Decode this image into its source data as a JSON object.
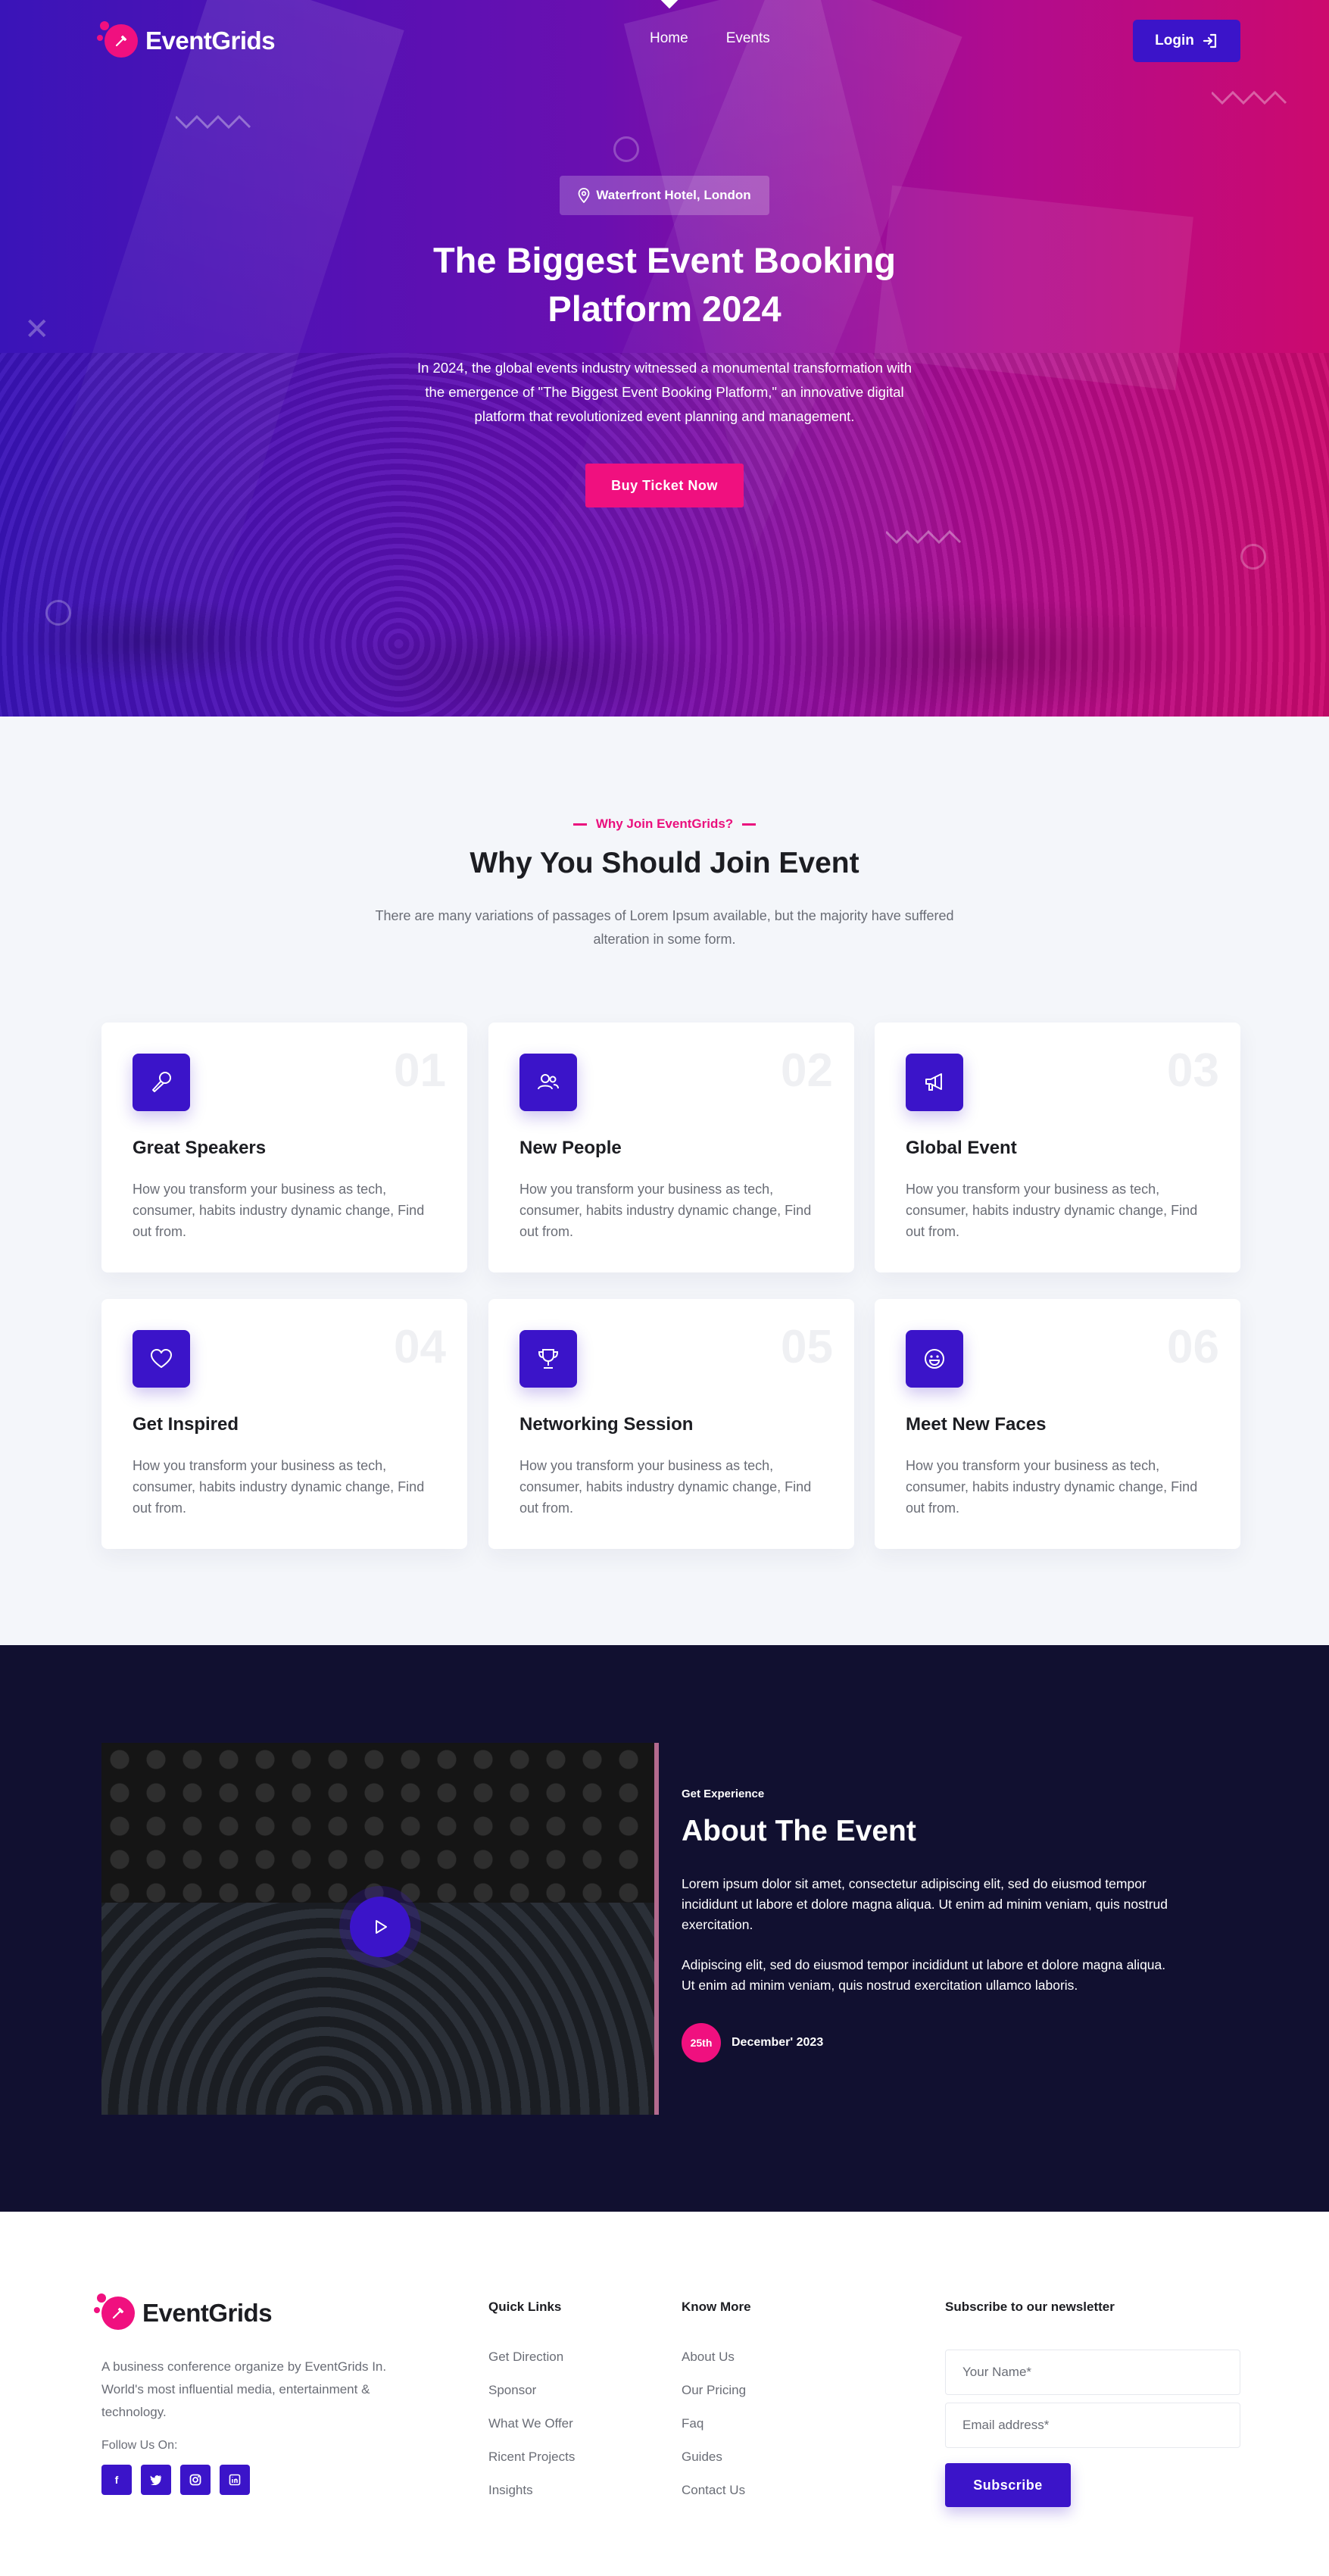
{
  "brand": {
    "name": "EventGrids"
  },
  "nav": {
    "links": [
      "Home",
      "Events"
    ],
    "login_label": "Login"
  },
  "hero": {
    "location": "Waterfront Hotel, London",
    "title": "The Biggest Event Booking Platform 2024",
    "description": "In 2024, the global events industry witnessed a monumental transformation with the emergence of \"The Biggest Event Booking Platform,\" an innovative digital platform that revolutionized event planning and management.",
    "cta_label": "Buy Ticket Now"
  },
  "why": {
    "eyebrow": "Why Join EventGrids?",
    "title": "Why You Should Join Event",
    "description": "There are many variations of passages of Lorem Ipsum available, but the majority have suffered alteration in some form.",
    "cards": [
      {
        "num": "01",
        "title": "Great Speakers",
        "icon": "microphone-icon",
        "desc": "How you transform your business as tech, consumer, habits industry dynamic change, Find out from."
      },
      {
        "num": "02",
        "title": "New People",
        "icon": "users-icon",
        "desc": "How you transform your business as tech, consumer, habits industry dynamic change, Find out from."
      },
      {
        "num": "03",
        "title": "Global Event",
        "icon": "megaphone-icon",
        "desc": "How you transform your business as tech, consumer, habits industry dynamic change, Find out from."
      },
      {
        "num": "04",
        "title": "Get Inspired",
        "icon": "heart-icon",
        "desc": "How you transform your business as tech, consumer, habits industry dynamic change, Find out from."
      },
      {
        "num": "05",
        "title": "Networking Session",
        "icon": "trophy-icon",
        "desc": "How you transform your business as tech, consumer, habits industry dynamic change, Find out from."
      },
      {
        "num": "06",
        "title": "Meet New Faces",
        "icon": "smile-icon",
        "desc": "How you transform your business as tech, consumer, habits industry dynamic change, Find out from."
      }
    ]
  },
  "about": {
    "eyebrow": "Get Experience",
    "title": "About The Event",
    "paragraphs": [
      "Lorem ipsum dolor sit amet, consectetur adipiscing elit, sed do eiusmod tempor incididunt ut labore et dolore magna aliqua. Ut enim ad minim veniam, quis nostrud exercitation.",
      "Adipiscing elit, sed do eiusmod tempor incididunt ut labore et dolore magna aliqua. Ut enim ad minim veniam, quis nostrud exercitation ullamco laboris."
    ],
    "date_badge": "25th",
    "date_text": "December' 2023"
  },
  "footer": {
    "about": "A business conference organize by EventGrids In. World's most influential media, entertainment & technology.",
    "follow_label": "Follow Us On:",
    "socials": [
      "facebook-icon",
      "twitter-icon",
      "instagram-icon",
      "linkedin-icon"
    ],
    "quick_links": {
      "title": "Quick Links",
      "items": [
        "Get Direction",
        "Sponsor",
        "What We Offer",
        "Ricent Projects",
        "Insights"
      ]
    },
    "know_more": {
      "title": "Know More",
      "items": [
        "About Us",
        "Our Pricing",
        "Faq",
        "Guides",
        "Contact Us"
      ]
    },
    "newsletter": {
      "title": "Subscribe to our newsletter",
      "name_placeholder": "Your Name*",
      "email_placeholder": "Email address*",
      "button_label": "Subscribe"
    }
  },
  "colors": {
    "primary": "#3b14c9",
    "accent": "#f0107f",
    "dark_bg": "#111030",
    "light_bg": "#f4f6fa"
  }
}
